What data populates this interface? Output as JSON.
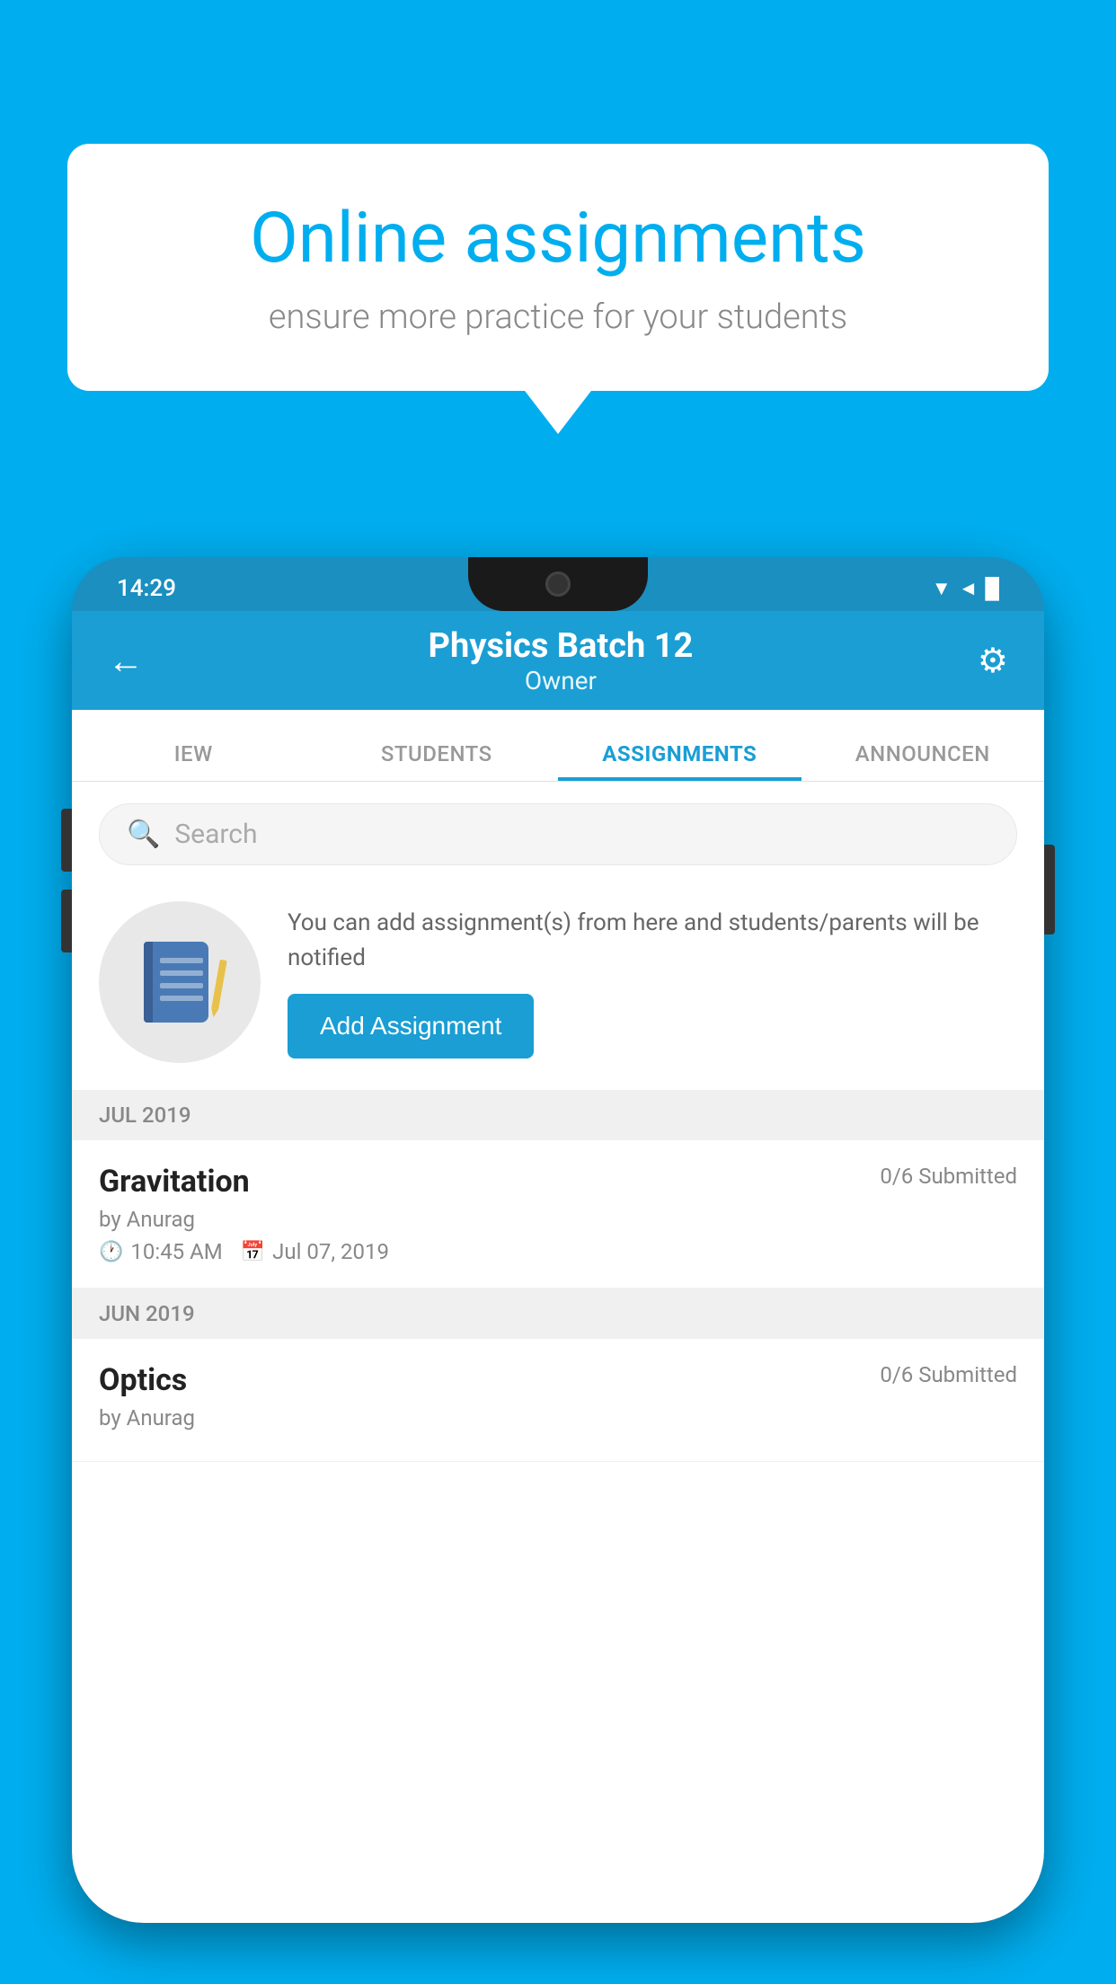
{
  "background": {
    "color": "#00AEEF"
  },
  "speech_bubble": {
    "title": "Online assignments",
    "subtitle": "ensure more practice for your students"
  },
  "status_bar": {
    "time": "14:29",
    "icons": "▼◄█"
  },
  "app_bar": {
    "title": "Physics Batch 12",
    "subtitle": "Owner",
    "back_icon": "←",
    "settings_icon": "⚙"
  },
  "tabs": [
    {
      "label": "IEW",
      "active": false
    },
    {
      "label": "STUDENTS",
      "active": false
    },
    {
      "label": "ASSIGNMENTS",
      "active": true
    },
    {
      "label": "ANNOUNCEN",
      "active": false
    }
  ],
  "search": {
    "placeholder": "Search"
  },
  "promo": {
    "description": "You can add assignment(s) from here and students/parents will be notified",
    "button_label": "Add Assignment"
  },
  "sections": [
    {
      "month_label": "JUL 2019",
      "assignments": [
        {
          "title": "Gravitation",
          "submitted": "0/6 Submitted",
          "author": "by Anurag",
          "time": "10:45 AM",
          "date": "Jul 07, 2019"
        }
      ]
    },
    {
      "month_label": "JUN 2019",
      "assignments": [
        {
          "title": "Optics",
          "submitted": "0/6 Submitted",
          "author": "by Anurag",
          "time": "",
          "date": ""
        }
      ]
    }
  ]
}
